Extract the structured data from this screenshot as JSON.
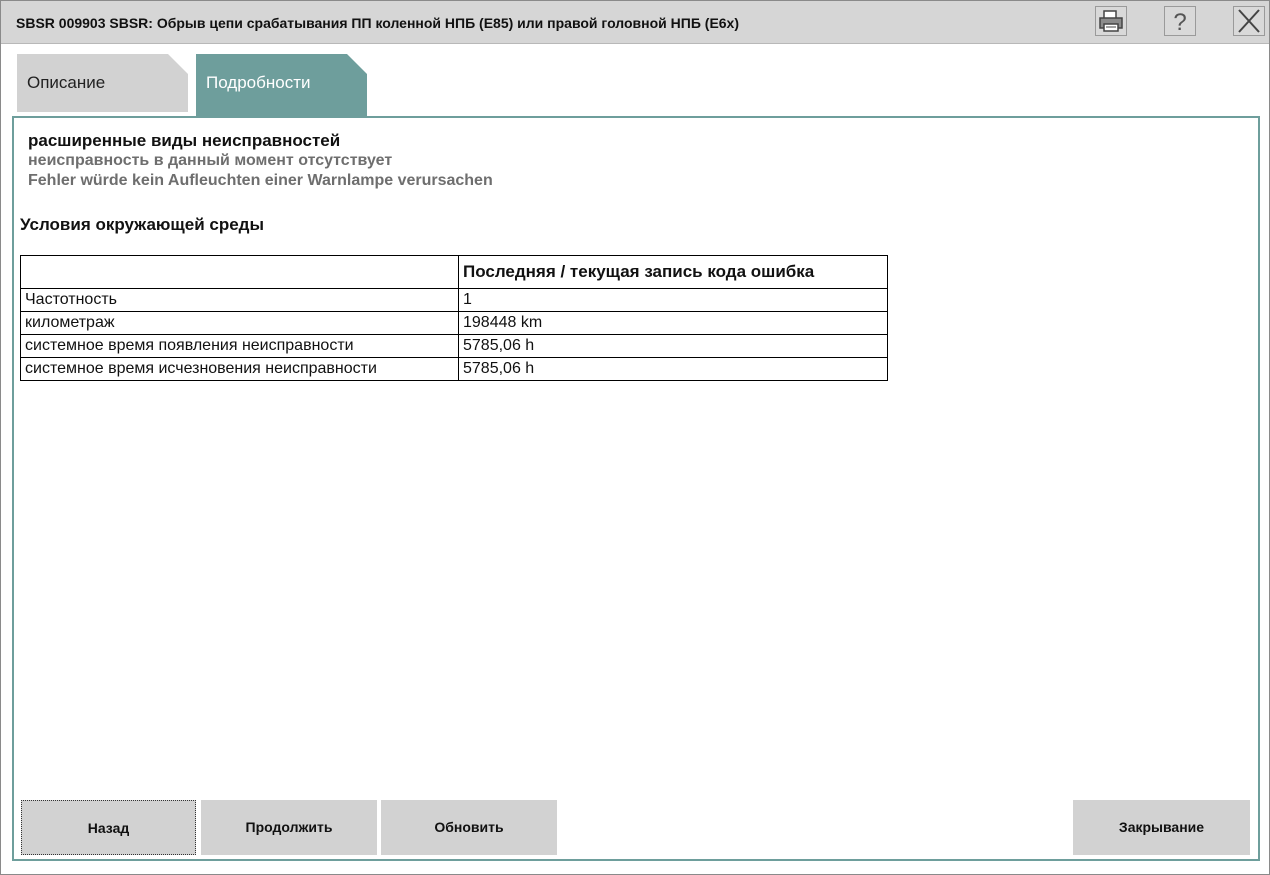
{
  "window": {
    "title": "SBSR 009903 SBSR: Обрыв цепи срабатывания ПП коленной НПБ (E85) или правой головной НПБ (E6x)",
    "print_icon": "printer-icon",
    "help_icon": "help-icon",
    "close_icon": "close-icon"
  },
  "tabs": [
    {
      "label": "Описание",
      "active": false
    },
    {
      "label": "Подробности",
      "active": true
    }
  ],
  "details": {
    "fault_heading": "расширенные виды неисправностей",
    "status_lines": [
      "неисправность в данный момент отсутствует",
      "Fehler würde kein Aufleuchten einer Warnlampe verursachen"
    ],
    "section_title": "Условия окружающей среды",
    "table": {
      "headers": [
        "",
        "Последняя / текущая запись кода ошибка"
      ],
      "rows": [
        [
          "Частотность",
          "1"
        ],
        [
          "километраж",
          "198448 km"
        ],
        [
          "системное время появления неисправности",
          "5785,06 h"
        ],
        [
          "системное время исчезновения неисправности",
          "5785,06 h"
        ]
      ]
    }
  },
  "buttons": {
    "back": "Назад",
    "continue": "Продолжить",
    "refresh": "Обновить",
    "close": "Закрывание"
  },
  "colors": {
    "accent": "#6e9e9c",
    "titlebar": "#d6d6d6",
    "button": "#d2d2d2"
  }
}
